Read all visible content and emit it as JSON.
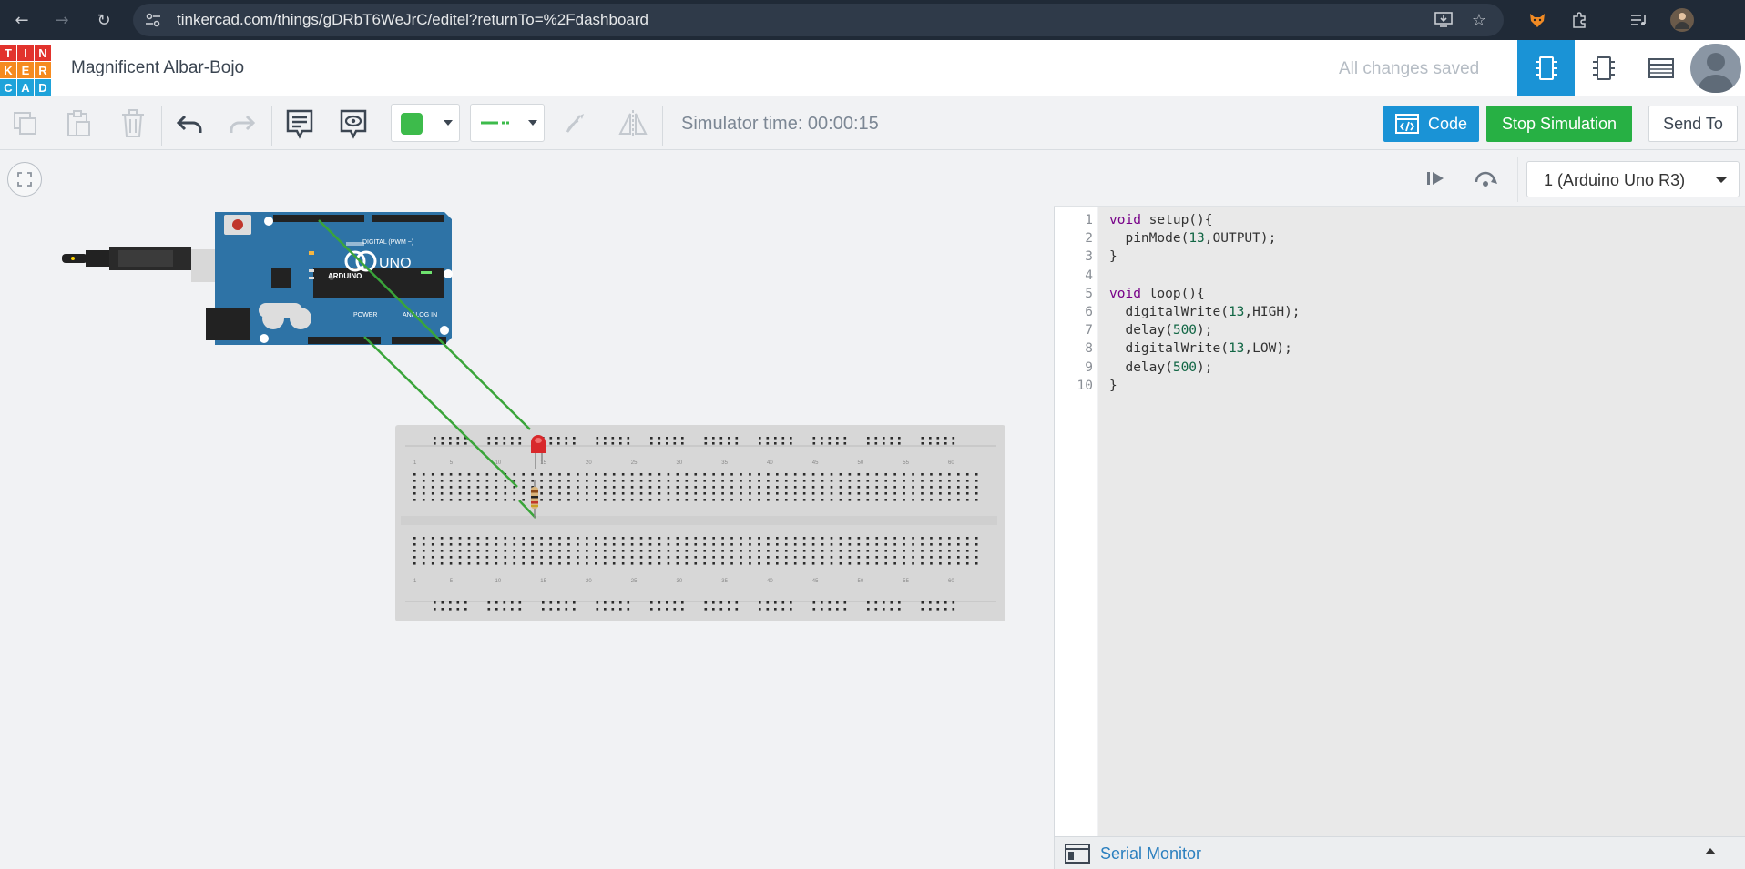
{
  "browser": {
    "url": "tinkercad.com/things/gDRbT6WeJrC/editel?returnTo=%2Fdashboard"
  },
  "logo": {
    "letters": [
      "T",
      "I",
      "N",
      "K",
      "E",
      "R",
      "C",
      "A",
      "D"
    ],
    "colors": [
      "#e2332d",
      "#e2332d",
      "#e2332d",
      "#f58a1f",
      "#f58a1f",
      "#f58a1f",
      "#1fa3da",
      "#1fa3da",
      "#1fa3da"
    ]
  },
  "header": {
    "project_title": "Magnificent Albar-Bojo",
    "save_status": "All changes saved"
  },
  "toolbar": {
    "simulator_time": "Simulator time: 00:00:15",
    "code_label": "Code",
    "stop_label": "Stop Simulation",
    "send_label": "Send To",
    "color_swatch": "#3dbb4b",
    "accent_blue": "#1a93d6",
    "accent_green": "#27b044"
  },
  "code": {
    "board_select": "1 (Arduino Uno R3)",
    "lines": [
      {
        "n": "1",
        "text": "void setup(){"
      },
      {
        "n": "2",
        "text": "  pinMode(13,OUTPUT);"
      },
      {
        "n": "3",
        "text": "}"
      },
      {
        "n": "4",
        "text": ""
      },
      {
        "n": "5",
        "text": "void loop(){"
      },
      {
        "n": "6",
        "text": "  digitalWrite(13,HIGH);"
      },
      {
        "n": "7",
        "text": "  delay(500);"
      },
      {
        "n": "8",
        "text": "  digitalWrite(13,LOW);"
      },
      {
        "n": "9",
        "text": "  delay(500);"
      },
      {
        "n": "10",
        "text": "}"
      }
    ]
  },
  "serial_monitor": {
    "label": "Serial Monitor"
  },
  "circuit": {
    "board_label": "UNO",
    "brand_label": "ARDUINO",
    "digital_label": "DIGITAL (PWM ~)",
    "power_label": "POWER",
    "analog_label": "ANALOG IN",
    "breadboard_numbers": [
      "1",
      "5",
      "10",
      "15",
      "20",
      "25",
      "30",
      "35",
      "40",
      "45",
      "50",
      "55",
      "60"
    ],
    "wire_color": "#3aa53a",
    "led_color": "#d8282b"
  }
}
